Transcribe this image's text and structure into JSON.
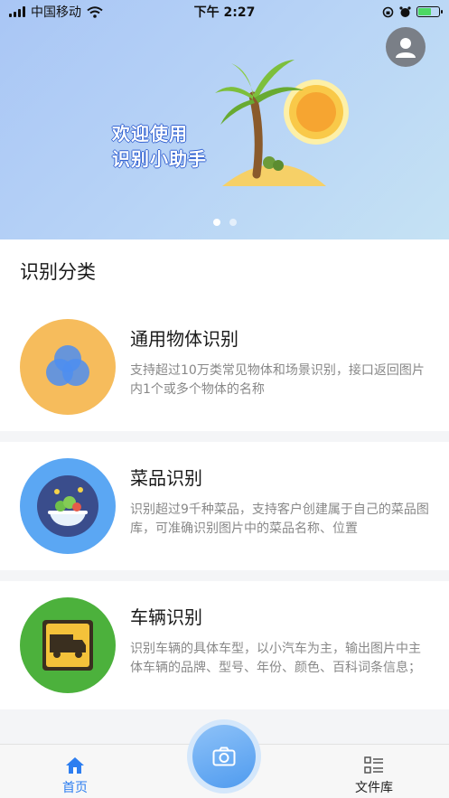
{
  "status_bar": {
    "carrier": "中国移动",
    "time": "下午 2:27"
  },
  "banner": {
    "line1": "欢迎使用",
    "line2": "识别小助手",
    "active_page": 1,
    "page_count": 2
  },
  "section": {
    "title": "识别分类"
  },
  "cards": [
    {
      "title": "通用物体识别",
      "desc": "支持超过10万类常见物体和场景识别，接口返回图片内1个或多个物体的名称",
      "icon": "overlapping-circles-icon",
      "color": "#f6bc5c"
    },
    {
      "title": "菜品识别",
      "desc": "识别超过9千种菜品，支持客户创建属于自己的菜品图库，可准确识别图片中的菜品名称、位置",
      "icon": "dish-bowl-icon",
      "color": "#5ba7f3"
    },
    {
      "title": "车辆识别",
      "desc": "识别车辆的具体车型，以小汽车为主，输出图片中主体车辆的品牌、型号、年份、颜色、百科词条信息；",
      "icon": "truck-icon",
      "color": "#4cb13c"
    }
  ],
  "tabbar": {
    "home": "首页",
    "files": "文件库",
    "camera_icon": "camera-icon"
  },
  "colors": {
    "accent": "#2d7ef0"
  }
}
